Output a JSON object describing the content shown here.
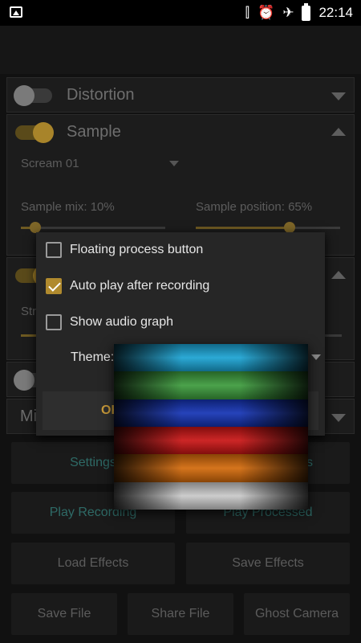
{
  "status_bar": {
    "time": "22:14",
    "icons": [
      "image-icon",
      "vibrate-icon",
      "alarm-icon",
      "airplane-icon",
      "battery-icon"
    ]
  },
  "sections": {
    "distortion": {
      "title": "Distortion",
      "enabled": false,
      "expanded": false
    },
    "sample": {
      "title": "Sample",
      "enabled": true,
      "expanded": true,
      "preset": "Scream 01",
      "mix_label": "Sample mix: 10%",
      "mix_value": 0.1,
      "position_label": "Sample position: 65%",
      "position_value": 0.65
    },
    "third": {
      "enabled": true,
      "expanded": true,
      "partial_label": "Str"
    },
    "fourth": {
      "enabled": false,
      "partial_label": "Mi"
    }
  },
  "buttons": {
    "settings": "Settings",
    "effects_partial": "s",
    "play_recording": "Play Recording",
    "play_processed": "Play Processed",
    "load_effects": "Load Effects",
    "save_effects": "Save Effects",
    "save_file": "Save File",
    "share_file": "Share File",
    "ghost_camera": "Ghost Camera"
  },
  "dialog": {
    "options": [
      {
        "label": "Floating process button",
        "checked": false
      },
      {
        "label": "Auto play after recording",
        "checked": true
      },
      {
        "label": "Show audio graph",
        "checked": false
      }
    ],
    "theme_label": "Theme:",
    "ok_label": "OK"
  },
  "theme_options": [
    {
      "name": "blue",
      "color": "#1aa2d2"
    },
    {
      "name": "green",
      "color": "#3c9a3c"
    },
    {
      "name": "navy",
      "color": "#1433b4"
    },
    {
      "name": "red",
      "color": "#c81414"
    },
    {
      "name": "orange",
      "color": "#d2690a"
    },
    {
      "name": "grey",
      "color": "#c8c8c8"
    }
  ],
  "colors": {
    "accent": "#b08a2e",
    "teal_button_text": "#2e6a66"
  }
}
